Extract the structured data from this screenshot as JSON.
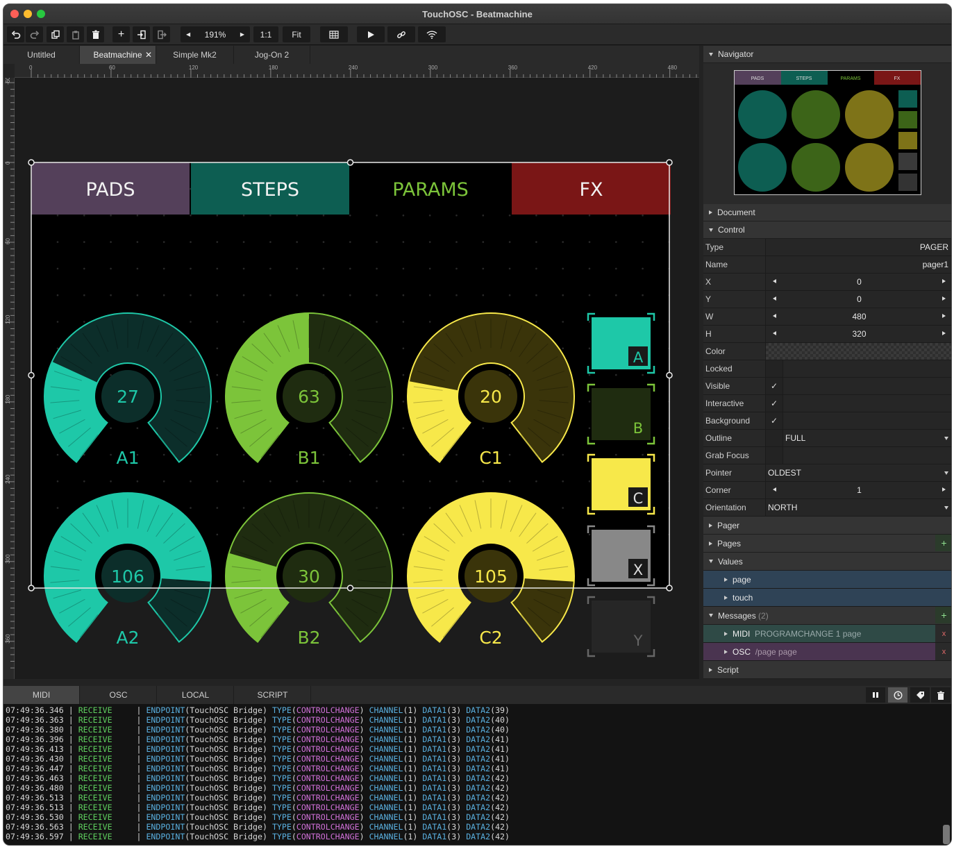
{
  "window": {
    "title": "TouchOSC - Beatmachine"
  },
  "toolbar": {
    "zoom": "191%",
    "one_to_one": "1:1",
    "fit": "Fit"
  },
  "tabs": [
    {
      "label": "Untitled",
      "active": false
    },
    {
      "label": "Beatmachine",
      "active": true
    },
    {
      "label": "Simple Mk2",
      "active": false
    },
    {
      "label": "Jog-On 2",
      "active": false
    }
  ],
  "ruler": {
    "h": [
      "0",
      "60",
      "120",
      "180",
      "240",
      "300",
      "360",
      "420",
      "480"
    ],
    "v": [
      "-60",
      "0",
      "60",
      "120",
      "180",
      "240",
      "300",
      "360"
    ]
  },
  "pager": {
    "tabs": [
      {
        "label": "PADS",
        "color": "#54405a"
      },
      {
        "label": "STEPS",
        "color": "#0d5e52"
      },
      {
        "label": "PARAMS",
        "color": "#000000",
        "text": "#7cc43a"
      },
      {
        "label": "FX",
        "color": "#7a1616"
      }
    ]
  },
  "knobs": [
    {
      "value": "27",
      "label": "A1",
      "fill": 0.27,
      "color": "#1ec8a8",
      "dark": "#0c2e2a"
    },
    {
      "value": "63",
      "label": "B1",
      "fill": 0.5,
      "color": "#7cc43a",
      "dark": "#1f2c10"
    },
    {
      "value": "20",
      "label": "C1",
      "fill": 0.22,
      "color": "#f7e84a",
      "dark": "#3a340a"
    },
    {
      "value": "106",
      "label": "A2",
      "fill": 0.83,
      "color": "#1ec8a8",
      "dark": "#0c2e2a"
    },
    {
      "value": "30",
      "label": "B2",
      "fill": 0.24,
      "color": "#7cc43a",
      "dark": "#1f2c10"
    },
    {
      "value": "105",
      "label": "C2",
      "fill": 0.83,
      "color": "#f7e84a",
      "dark": "#3a340a"
    }
  ],
  "buttons": [
    {
      "label": "A",
      "color": "#1ec8a8",
      "on": true
    },
    {
      "label": "B",
      "color": "#7cc43a",
      "on": false
    },
    {
      "label": "C",
      "color": "#f7e84a",
      "on": true
    },
    {
      "label": "X",
      "color": "#888888",
      "on": true
    },
    {
      "label": "Y",
      "color": "#3a3a3a",
      "on": false
    }
  ],
  "navigator": {
    "title": "Navigator",
    "tabs": [
      "PADS",
      "STEPS",
      "PARAMS",
      "FX"
    ]
  },
  "panel": {
    "document": "Document",
    "control": "Control",
    "type": {
      "label": "Type",
      "value": "PAGER"
    },
    "name": {
      "label": "Name",
      "value": "pager1"
    },
    "x": {
      "label": "X",
      "value": "0"
    },
    "y": {
      "label": "Y",
      "value": "0"
    },
    "w": {
      "label": "W",
      "value": "480"
    },
    "h": {
      "label": "H",
      "value": "320"
    },
    "color": {
      "label": "Color"
    },
    "locked": {
      "label": "Locked",
      "checked": ""
    },
    "visible": {
      "label": "Visible",
      "checked": "✓"
    },
    "interactive": {
      "label": "Interactive",
      "checked": "✓"
    },
    "background": {
      "label": "Background",
      "checked": "✓"
    },
    "outline": {
      "label": "Outline",
      "value": "FULL"
    },
    "grabfocus": {
      "label": "Grab Focus",
      "checked": ""
    },
    "pointer": {
      "label": "Pointer",
      "value": "OLDEST"
    },
    "corner": {
      "label": "Corner",
      "value": "1"
    },
    "orientation": {
      "label": "Orientation",
      "value": "NORTH"
    },
    "pager": "Pager",
    "pages": "Pages",
    "values": "Values",
    "value_items": [
      "page",
      "touch"
    ],
    "messages": "Messages",
    "messages_count": "(2)",
    "msg_midi": {
      "kind": "MIDI",
      "detail": "PROGRAMCHANGE 1 page"
    },
    "msg_osc": {
      "kind": "OSC",
      "detail": "/page page"
    },
    "script": "Script"
  },
  "console": {
    "tabs": [
      "MIDI",
      "OSC",
      "LOCAL",
      "SCRIPT"
    ],
    "rows": [
      {
        "t": "07:49:36.346",
        "v": "39"
      },
      {
        "t": "07:49:36.363",
        "v": "40"
      },
      {
        "t": "07:49:36.380",
        "v": "40"
      },
      {
        "t": "07:49:36.396",
        "v": "41"
      },
      {
        "t": "07:49:36.413",
        "v": "41"
      },
      {
        "t": "07:49:36.430",
        "v": "41"
      },
      {
        "t": "07:49:36.447",
        "v": "41"
      },
      {
        "t": "07:49:36.463",
        "v": "42"
      },
      {
        "t": "07:49:36.480",
        "v": "42"
      },
      {
        "t": "07:49:36.513",
        "v": "42"
      },
      {
        "t": "07:49:36.513",
        "v": "42"
      },
      {
        "t": "07:49:36.530",
        "v": "42"
      },
      {
        "t": "07:49:36.563",
        "v": "42"
      },
      {
        "t": "07:49:36.597",
        "v": "42"
      }
    ],
    "receive": "RECEIVE",
    "endpoint": "TouchOSC Bridge",
    "type": "CONTROLCHANGE",
    "channel": "1",
    "data1": "3"
  }
}
